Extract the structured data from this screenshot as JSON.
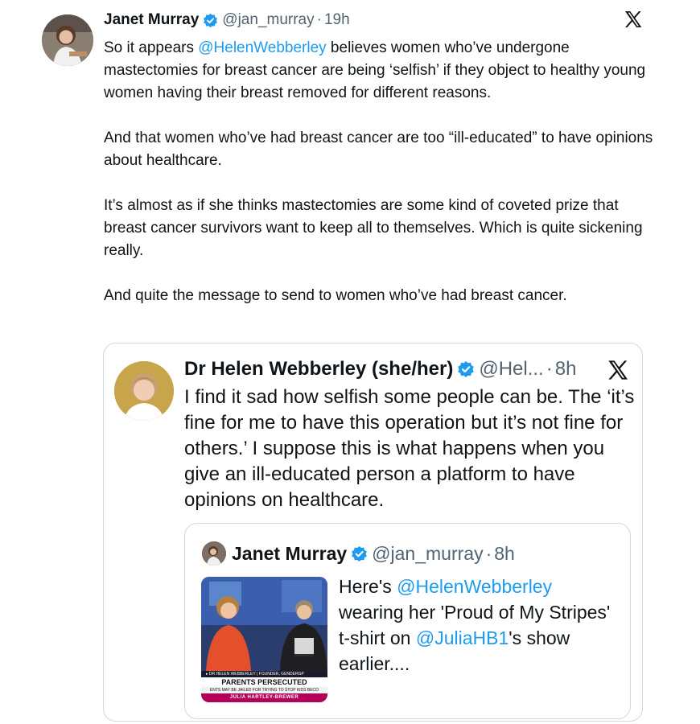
{
  "tweet": {
    "author_name": "Janet Murray",
    "author_handle": "@jan_murray",
    "separator": "·",
    "time": "19h",
    "x_logo": "x-logo-icon",
    "verified_icon": "verified-badge-icon",
    "avatar": "avatar-photo-icon",
    "text_parts": [
      "So it appears ",
      "@HelenWebberley",
      " believes women who’ve undergone mastectomies for breast cancer are being ‘selfish’ if they object to healthy young women having their breast removed for different reasons.\n\nAnd that women who’ve had breast cancer are too “ill-educated” to have opinions about healthcare.\n\nIt’s almost as if she thinks mastectomies are some kind of coveted prize that breast cancer survivors want to keep all to themselves. Which is quite sickening really.\n\nAnd quite the message to send to women who’ve had breast cancer."
    ]
  },
  "quoted_tweet": {
    "author_name": "Dr Helen Webberley (she/her)",
    "author_handle": "@Hel...",
    "separator": "·",
    "time": "8h",
    "text": "I find it sad how selfish some people can be. The ‘it’s fine for me to have this operation but it’s not fine for others.’ I suppose this is what happens when you give an ill-educated person a platform to have opinions on healthcare."
  },
  "nested_quote": {
    "author_name": "Janet Murray",
    "author_handle": "@jan_murray",
    "separator": "·",
    "time": "8h",
    "text_parts": [
      "Here's ",
      "@HelenWebberley",
      "\nwearing her 'Proud of My Stripes' t-shirt on ",
      "@JuliaHB1",
      "'s show earlier...."
    ],
    "media": {
      "caption_line": "▸ DR HELEN WEBBERLEY | FOUNDER, GENDERGP",
      "headline": "PARENTS PERSECUTED",
      "subline": "ENTS MAY BE JAILED FOR TRYING TO STOP KIDS BECO",
      "show": "JULIA HARTLEY-BREWER"
    }
  },
  "colors": {
    "accent": "#1d9bf0",
    "text": "#0f1419",
    "muted": "#536471",
    "border": "#cfd9de"
  }
}
